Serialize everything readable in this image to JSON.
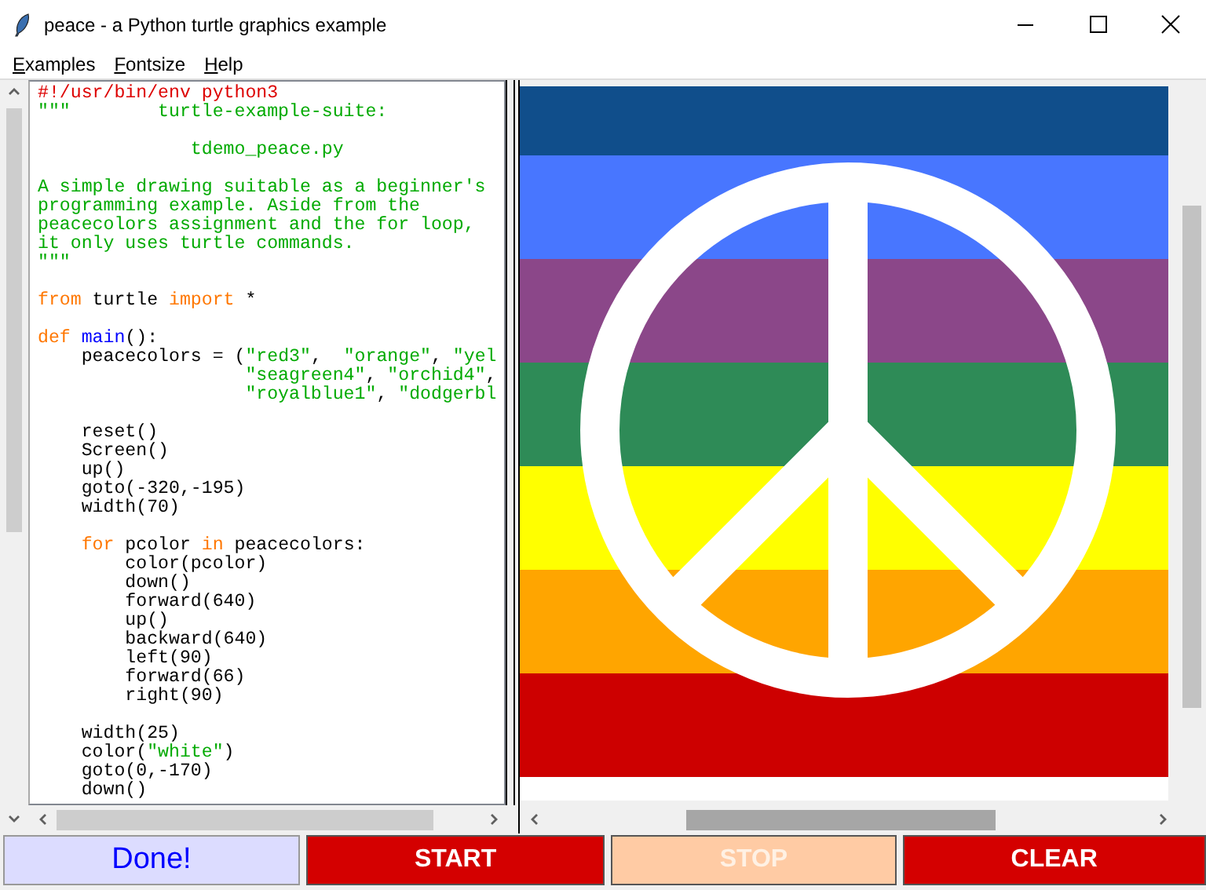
{
  "window": {
    "title": "peace - a Python turtle graphics example"
  },
  "menu": [
    {
      "label": "Examples"
    },
    {
      "label": "Fontsize"
    },
    {
      "label": "Help"
    }
  ],
  "code_lines": [
    {
      "kind": "code",
      "tokens": [
        {
          "kind": "shebang",
          "text": "#!/usr/bin/env python3"
        }
      ]
    },
    {
      "kind": "code",
      "tokens": [
        {
          "kind": "string",
          "text": "\"\"\"        turtle-example-suite:"
        }
      ]
    },
    {
      "kind": "blank"
    },
    {
      "kind": "code",
      "tokens": [
        {
          "kind": "string",
          "text": "              tdemo_peace.py"
        }
      ]
    },
    {
      "kind": "blank"
    },
    {
      "kind": "code",
      "tokens": [
        {
          "kind": "string",
          "text": "A simple drawing suitable as a beginner's"
        }
      ]
    },
    {
      "kind": "code",
      "tokens": [
        {
          "kind": "string",
          "text": "programming example. Aside from the"
        }
      ]
    },
    {
      "kind": "code",
      "tokens": [
        {
          "kind": "string",
          "text": "peacecolors assignment and the for loop,"
        }
      ]
    },
    {
      "kind": "code",
      "tokens": [
        {
          "kind": "string",
          "text": "it only uses turtle commands."
        }
      ]
    },
    {
      "kind": "code",
      "tokens": [
        {
          "kind": "string",
          "text": "\"\"\""
        }
      ]
    },
    {
      "kind": "blank"
    },
    {
      "kind": "code",
      "tokens": [
        {
          "kind": "keyword",
          "text": "from"
        },
        {
          "kind": "plain",
          "text": " turtle "
        },
        {
          "kind": "keyword",
          "text": "import"
        },
        {
          "kind": "plain",
          "text": " *"
        }
      ]
    },
    {
      "kind": "blank"
    },
    {
      "kind": "code",
      "tokens": [
        {
          "kind": "keyword",
          "text": "def"
        },
        {
          "kind": "defname",
          "text": " main"
        },
        {
          "kind": "plain",
          "text": "():"
        }
      ]
    },
    {
      "kind": "code",
      "tokens": [
        {
          "kind": "plain",
          "text": "    peacecolors = ("
        },
        {
          "kind": "string",
          "text": "\"red3\""
        },
        {
          "kind": "plain",
          "text": ",  "
        },
        {
          "kind": "string",
          "text": "\"orange\""
        },
        {
          "kind": "plain",
          "text": ", "
        },
        {
          "kind": "string",
          "text": "\"yel"
        }
      ]
    },
    {
      "kind": "code",
      "tokens": [
        {
          "kind": "string",
          "text": "                   \"seagreen4\""
        },
        {
          "kind": "plain",
          "text": ", "
        },
        {
          "kind": "string",
          "text": "\"orchid4\""
        },
        {
          "kind": "plain",
          "text": ","
        }
      ]
    },
    {
      "kind": "code",
      "tokens": [
        {
          "kind": "string",
          "text": "                   \"royalblue1\""
        },
        {
          "kind": "plain",
          "text": ", "
        },
        {
          "kind": "string",
          "text": "\"dodgerbl"
        }
      ]
    },
    {
      "kind": "blank"
    },
    {
      "kind": "code",
      "tokens": [
        {
          "kind": "plain",
          "text": "    reset()"
        }
      ]
    },
    {
      "kind": "code",
      "tokens": [
        {
          "kind": "plain",
          "text": "    Screen()"
        }
      ]
    },
    {
      "kind": "code",
      "tokens": [
        {
          "kind": "plain",
          "text": "    up()"
        }
      ]
    },
    {
      "kind": "code",
      "tokens": [
        {
          "kind": "plain",
          "text": "    goto(-320,-195)"
        }
      ]
    },
    {
      "kind": "code",
      "tokens": [
        {
          "kind": "plain",
          "text": "    width(70)"
        }
      ]
    },
    {
      "kind": "blank"
    },
    {
      "kind": "code",
      "tokens": [
        {
          "kind": "keyword",
          "text": "    for"
        },
        {
          "kind": "plain",
          "text": " pcolor "
        },
        {
          "kind": "keyword",
          "text": "in"
        },
        {
          "kind": "plain",
          "text": " peacecolors:"
        }
      ]
    },
    {
      "kind": "code",
      "tokens": [
        {
          "kind": "plain",
          "text": "        color(pcolor)"
        }
      ]
    },
    {
      "kind": "code",
      "tokens": [
        {
          "kind": "plain",
          "text": "        down()"
        }
      ]
    },
    {
      "kind": "code",
      "tokens": [
        {
          "kind": "plain",
          "text": "        forward(640)"
        }
      ]
    },
    {
      "kind": "code",
      "tokens": [
        {
          "kind": "plain",
          "text": "        up()"
        }
      ]
    },
    {
      "kind": "code",
      "tokens": [
        {
          "kind": "plain",
          "text": "        backward(640)"
        }
      ]
    },
    {
      "kind": "code",
      "tokens": [
        {
          "kind": "plain",
          "text": "        left(90)"
        }
      ]
    },
    {
      "kind": "code",
      "tokens": [
        {
          "kind": "plain",
          "text": "        forward(66)"
        }
      ]
    },
    {
      "kind": "code",
      "tokens": [
        {
          "kind": "plain",
          "text": "        right(90)"
        }
      ]
    },
    {
      "kind": "blank"
    },
    {
      "kind": "code",
      "tokens": [
        {
          "kind": "plain",
          "text": "    width(25)"
        }
      ]
    },
    {
      "kind": "code",
      "tokens": [
        {
          "kind": "plain",
          "text": "    color("
        },
        {
          "kind": "string",
          "text": "\"white\""
        },
        {
          "kind": "plain",
          "text": ")"
        }
      ]
    },
    {
      "kind": "code",
      "tokens": [
        {
          "kind": "plain",
          "text": "    goto(0,-170)"
        }
      ]
    },
    {
      "kind": "code",
      "tokens": [
        {
          "kind": "plain",
          "text": "    down()"
        }
      ]
    }
  ],
  "buttons": [
    {
      "kind": "label",
      "label": "Done!"
    },
    {
      "kind": "button",
      "label": "START",
      "disabled": false
    },
    {
      "kind": "button",
      "label": "STOP",
      "disabled": true
    },
    {
      "kind": "button",
      "label": "CLEAR",
      "disabled": false
    }
  ]
}
